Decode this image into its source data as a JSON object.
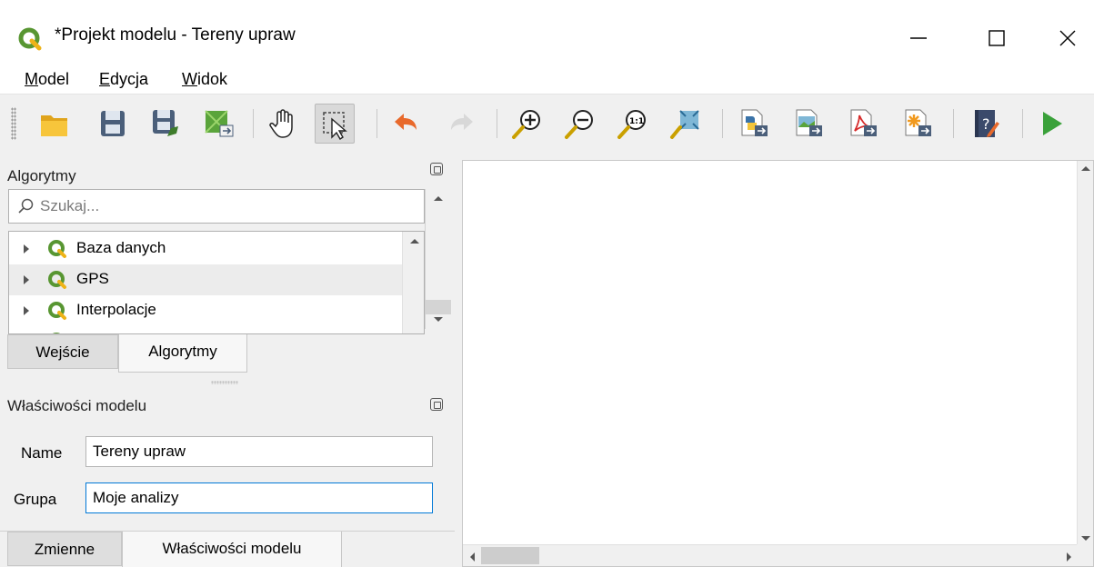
{
  "window": {
    "title": "*Projekt modelu - Tereny upraw",
    "app_icon": "qgis-icon",
    "controls": [
      "minimize-icon",
      "maximize-icon",
      "close-icon"
    ]
  },
  "menu": {
    "items": [
      {
        "accel": "M",
        "rest": "odel"
      },
      {
        "accel": "E",
        "rest": "dycja"
      },
      {
        "accel": "W",
        "rest": "idok"
      }
    ]
  },
  "toolbar": {
    "buttons": [
      "open-model-icon",
      "save-model-icon",
      "save-as-icon",
      "save-in-project-icon",
      "pan-icon",
      "select-icon",
      "undo-icon",
      "redo-icon",
      "zoom-in-icon",
      "zoom-out-icon",
      "zoom-actual-icon",
      "zoom-full-icon",
      "export-python-icon",
      "export-image-icon",
      "export-pdf-icon",
      "export-svg-icon",
      "edit-help-icon",
      "run-model-icon"
    ],
    "pressed": "select-icon"
  },
  "algorithms_panel": {
    "title": "Algorytmy",
    "search_placeholder": "Szukaj...",
    "tree": [
      "Baza danych",
      "GPS",
      "Interpolacje"
    ]
  },
  "tabs_top": {
    "input": "Wejście",
    "algorithms": "Algorytmy",
    "active": "algorithms"
  },
  "properties_panel": {
    "title": "Właściwości modelu",
    "name_label": "Name",
    "name_value": "Tereny upraw",
    "group_label": "Grupa",
    "group_value": "Moje analizy"
  },
  "tabs_bottom": {
    "variables": "Zmienne",
    "properties": "Właściwości modelu",
    "active": "properties"
  },
  "colors": {
    "qgis_green": "#589632",
    "qgis_yellow": "#eeb318",
    "focus_blue": "#0078d7",
    "run_green": "#3aa13a",
    "undo_orange": "#e8692b"
  }
}
